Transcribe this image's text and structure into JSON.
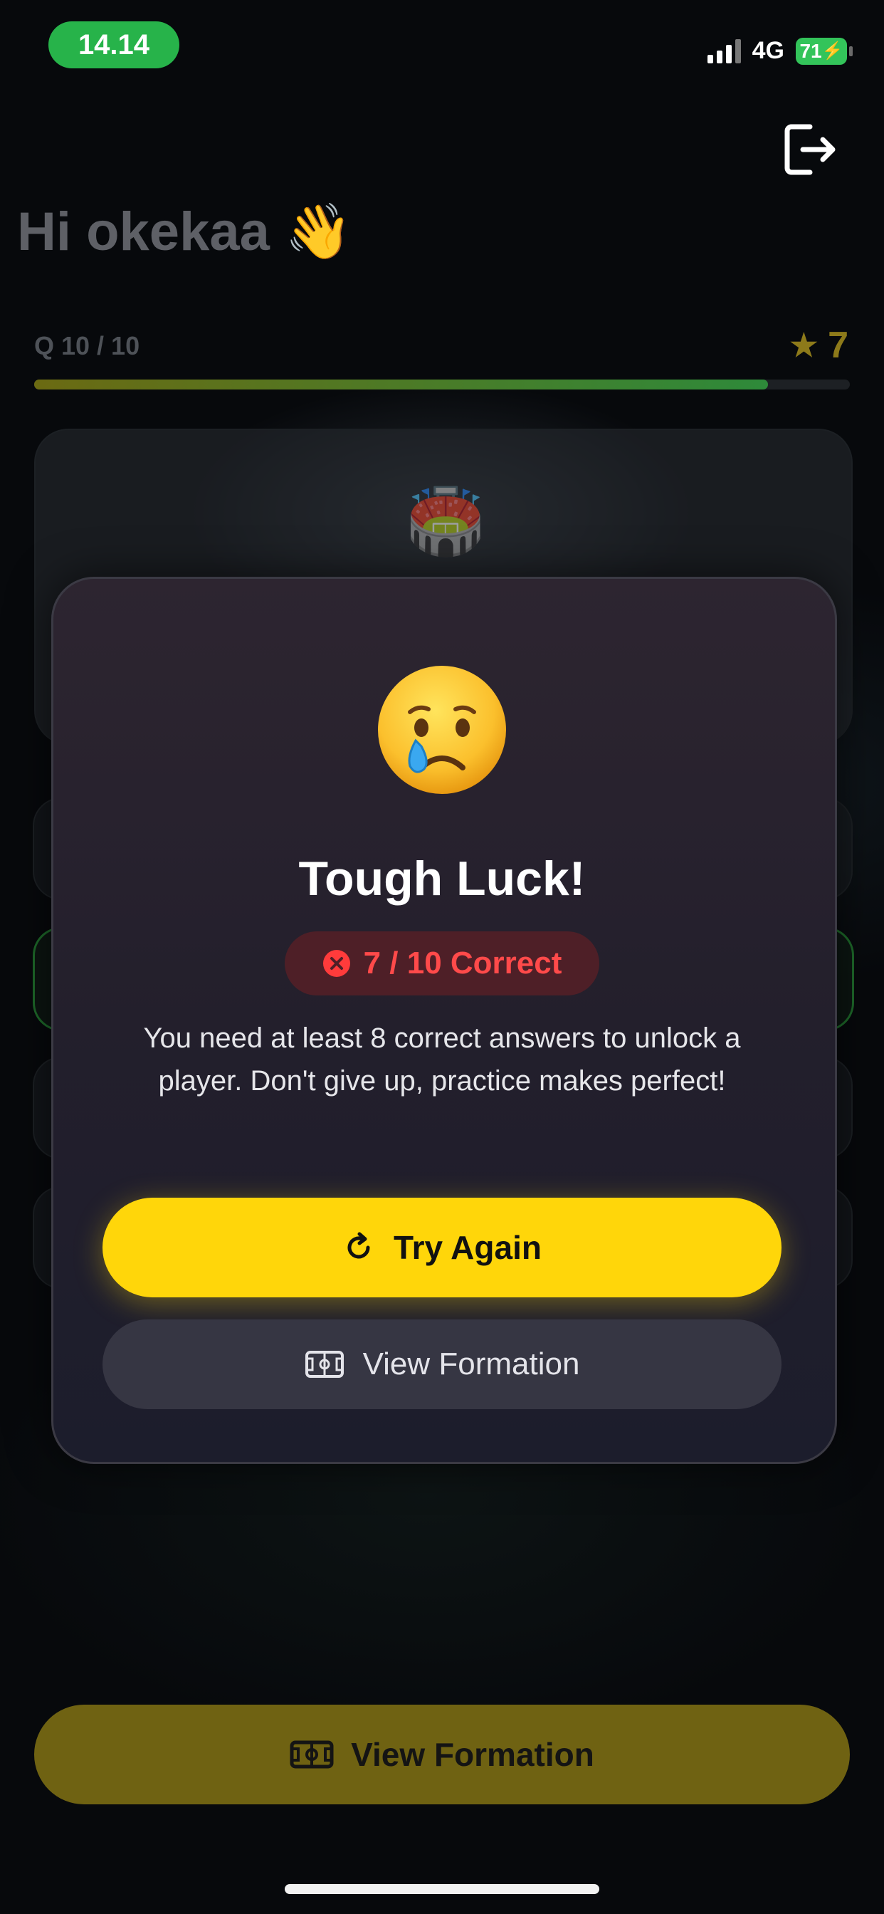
{
  "status_bar": {
    "time": "14.14",
    "network": "4G",
    "battery": "71"
  },
  "header": {
    "greeting": "Hi okekaa 👋",
    "logout_icon": "logout-icon"
  },
  "quiz": {
    "question_counter": "Q 10 / 10",
    "score": "7",
    "progress_fraction": 0.9,
    "stadium_icon": "🏟️"
  },
  "modal": {
    "emoji": "crying-face-icon",
    "title": "Tough Luck!",
    "result": "7 / 10 Correct",
    "message": "You need at least 8 correct answers to unlock a player. Don't give up, practice makes perfect!",
    "primary_button": "Try Again",
    "secondary_button": "View Formation"
  },
  "bottom_button": "View Formation",
  "colors": {
    "accent_yellow": "#ffd60a",
    "error_red": "#ff4a4a",
    "status_green": "#27b34a"
  }
}
